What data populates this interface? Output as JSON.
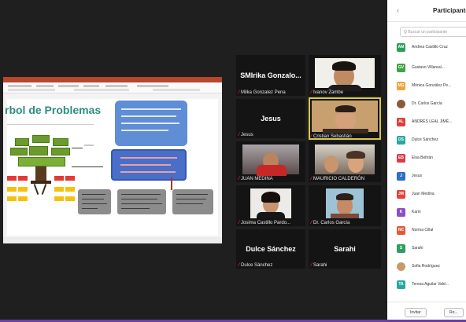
{
  "slide": {
    "title": "rbol de Problemas"
  },
  "gallery": {
    "tiles": [
      {
        "id": "milka",
        "center_name": "SMIrika Gonzalo...",
        "label": "Milka Gonzalez Pena",
        "video": false
      },
      {
        "id": "ivanzp",
        "center_name": "",
        "label": "Ivanov Zambe",
        "video": true
      },
      {
        "id": "jesus",
        "center_name": "Jesus",
        "label": "Jesus",
        "video": false
      },
      {
        "id": "ivamper",
        "center_name": "",
        "label": "Cristian Sebastián",
        "video": true
      },
      {
        "id": "juan",
        "center_name": "",
        "label": "JUAN MEDINA",
        "video": true
      },
      {
        "id": "mauricio",
        "center_name": "",
        "label": "MAURICIO CALDERÓN",
        "video": true
      },
      {
        "id": "lesma",
        "center_name": "",
        "label": "Josima Castillo Pardo...",
        "video": true
      },
      {
        "id": "garcia",
        "center_name": "",
        "label": "Dr. Carlos García",
        "video": true
      },
      {
        "id": "dulce",
        "center_name": "Dulce Sánchez",
        "label": "Dulce Sánchez",
        "video": false
      },
      {
        "id": "sarahi",
        "center_name": "Sarahi",
        "label": "Sarahi",
        "video": false
      }
    ]
  },
  "panel": {
    "title": "Participantes",
    "search_placeholder": "Q Buscar un participante",
    "participants": [
      {
        "initials": "AM",
        "color": "#2e9e5e",
        "name": "Andrea Castillo Cruz"
      },
      {
        "initials": "GV",
        "color": "#43a047",
        "name": "Gustavo Villareal..."
      },
      {
        "initials": "MG",
        "color": "#f2a33a",
        "name": "Mónica González Pe..."
      },
      {
        "initials": "",
        "color": "#8b5a3c",
        "name": "Dr. Carlos García",
        "photo": true
      },
      {
        "initials": "AL",
        "color": "#d9413a",
        "name": "ANDRÉS LEAL JIMÉ..."
      },
      {
        "initials": "DS",
        "color": "#2aa6a0",
        "name": "Dulce Sánchez"
      },
      {
        "initials": "EB",
        "color": "#d93b4a",
        "name": "Elsa Beltrán"
      },
      {
        "initials": "J",
        "color": "#2d6fc9",
        "name": "Jesus"
      },
      {
        "initials": "JM",
        "color": "#e0453c",
        "name": "Juan Medina"
      },
      {
        "initials": "K",
        "color": "#8a4fc9",
        "name": "Karin"
      },
      {
        "initials": "NC",
        "color": "#e05a3a",
        "name": "Norma Cillal"
      },
      {
        "initials": "S",
        "color": "#2e9e5e",
        "name": "Sarahi"
      },
      {
        "initials": "",
        "color": "#c79a6a",
        "name": "Sofia Rodríguez",
        "photo": true
      },
      {
        "initials": "TA",
        "color": "#2aa6a0",
        "name": "Teresa Aguilar Vald..."
      }
    ],
    "footer": {
      "invite_label": "Invitar",
      "more_label": "Ro..."
    }
  }
}
